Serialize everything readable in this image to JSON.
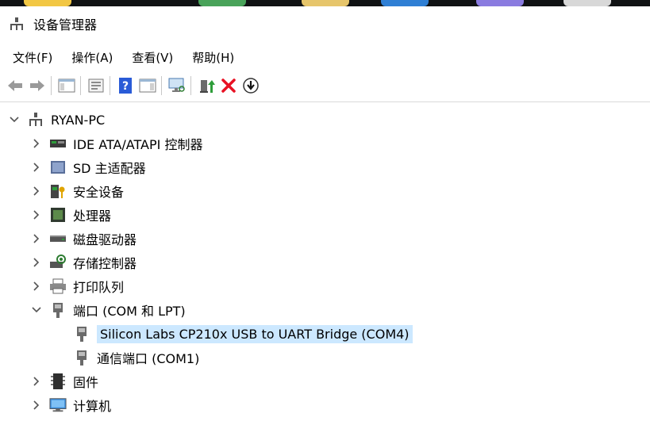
{
  "window": {
    "title": "设备管理器"
  },
  "menu": [
    "文件(F)",
    "操作(A)",
    "查看(V)",
    "帮助(H)"
  ],
  "toolbar": {
    "buttons": [
      "back-icon",
      "forward-icon",
      "console-tree-icon",
      "properties-icon",
      "help-icon",
      "action-pane-icon",
      "scan-hardware-icon",
      "update-driver-icon",
      "uninstall-icon",
      "disable-icon"
    ]
  },
  "tree": {
    "root": "RYAN-PC",
    "items": [
      {
        "label": "IDE ATA/ATAPI 控制器",
        "icon": "ide-controller-icon",
        "expanded": false
      },
      {
        "label": "SD 主适配器",
        "icon": "sd-host-icon",
        "expanded": false
      },
      {
        "label": "安全设备",
        "icon": "security-device-icon",
        "expanded": false
      },
      {
        "label": "处理器",
        "icon": "processor-icon",
        "expanded": false
      },
      {
        "label": "磁盘驱动器",
        "icon": "disk-drive-icon",
        "expanded": false
      },
      {
        "label": "存储控制器",
        "icon": "storage-controller-icon",
        "expanded": false
      },
      {
        "label": "打印队列",
        "icon": "print-queue-icon",
        "expanded": false
      },
      {
        "label": "端口 (COM 和 LPT)",
        "icon": "port-icon",
        "expanded": true,
        "children": [
          {
            "label": "Silicon Labs CP210x USB to UART Bridge (COM4)",
            "icon": "port-device-icon",
            "selected": true
          },
          {
            "label": "通信端口 (COM1)",
            "icon": "port-device-icon",
            "selected": false
          }
        ]
      },
      {
        "label": "固件",
        "icon": "firmware-icon",
        "expanded": false
      },
      {
        "label": "计算机",
        "icon": "computer-icon",
        "expanded": false
      }
    ]
  },
  "colors": {
    "selection": "#cce8ff",
    "uninstall_red": "#e81123",
    "help_blue": "#2a5bd7"
  }
}
